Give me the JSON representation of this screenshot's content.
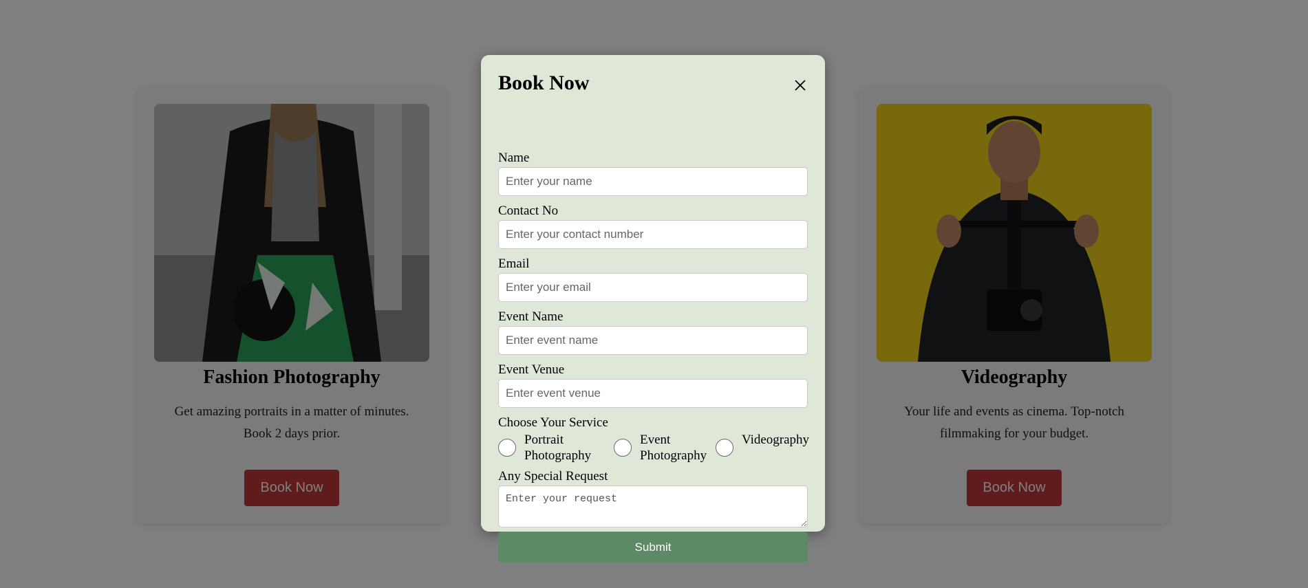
{
  "cards": [
    {
      "title": "Fashion Photography",
      "description": "Get amazing portraits in a matter of minutes. Book 2 days prior.",
      "button_label": "Book Now"
    },
    {
      "title": "Videography",
      "description": "Your life and events as cinema. Top-notch filmmaking for your budget.",
      "button_label": "Book Now"
    }
  ],
  "modal": {
    "title": "Book Now",
    "close_icon": "close-icon",
    "fields": {
      "name": {
        "label": "Name",
        "placeholder": "Enter your name"
      },
      "contact": {
        "label": "Contact No",
        "placeholder": "Enter your contact number"
      },
      "email": {
        "label": "Email",
        "placeholder": "Enter your email"
      },
      "event_name": {
        "label": "Event Name",
        "placeholder": "Enter event name"
      },
      "event_venue": {
        "label": "Event Venue",
        "placeholder": "Enter event venue"
      }
    },
    "service": {
      "label": "Choose Your Service",
      "options": [
        "Portrait Photography",
        "Event Photography",
        "Videography"
      ]
    },
    "request": {
      "label": "Any Special Request",
      "placeholder": "Enter your request"
    },
    "submit_label": "Submit"
  },
  "colors": {
    "modal_bg": "#dfe7d8",
    "submit_bg": "#5b8a64",
    "book_button_bg": "#c0393b",
    "overlay": "rgba(0,0,0,0.5)"
  }
}
